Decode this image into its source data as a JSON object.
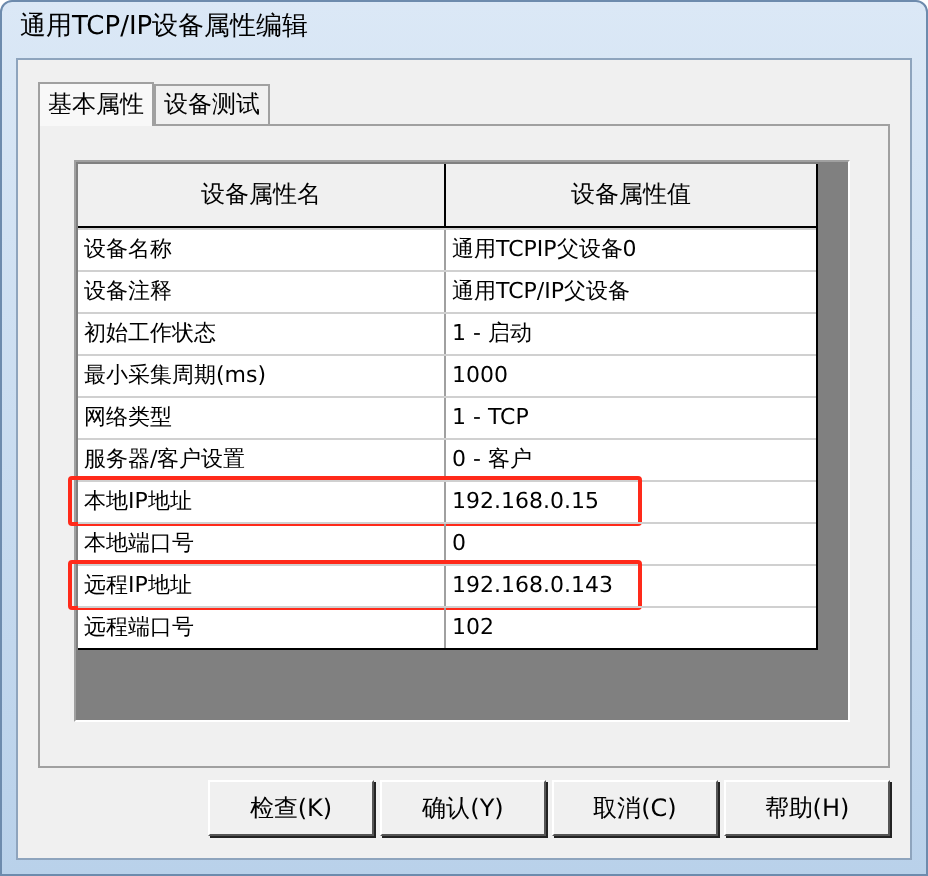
{
  "window": {
    "title": "通用TCP/IP设备属性编辑"
  },
  "tabs": [
    {
      "label": "基本属性",
      "selected": true
    },
    {
      "label": "设备测试",
      "selected": false
    }
  ],
  "table": {
    "columns": [
      "设备属性名",
      "设备属性值"
    ],
    "rows": [
      {
        "name": "设备名称",
        "value": "通用TCPIP父设备0",
        "highlighted": false
      },
      {
        "name": "设备注释",
        "value": "通用TCP/IP父设备",
        "highlighted": false
      },
      {
        "name": "初始工作状态",
        "value": "1 - 启动",
        "highlighted": false
      },
      {
        "name": "最小采集周期(ms)",
        "value": "1000",
        "highlighted": false
      },
      {
        "name": "网络类型",
        "value": "1 - TCP",
        "highlighted": false
      },
      {
        "name": "服务器/客户设置",
        "value": "0 - 客户",
        "highlighted": false
      },
      {
        "name": "本地IP地址",
        "value": "192.168.0.15",
        "highlighted": true
      },
      {
        "name": "本地端口号",
        "value": "0",
        "highlighted": false
      },
      {
        "name": "远程IP地址",
        "value": "192.168.0.143",
        "highlighted": true
      },
      {
        "name": "远程端口号",
        "value": "102",
        "highlighted": false
      }
    ]
  },
  "buttons": [
    "检查(K)",
    "确认(Y)",
    "取消(C)",
    "帮助(H)"
  ]
}
